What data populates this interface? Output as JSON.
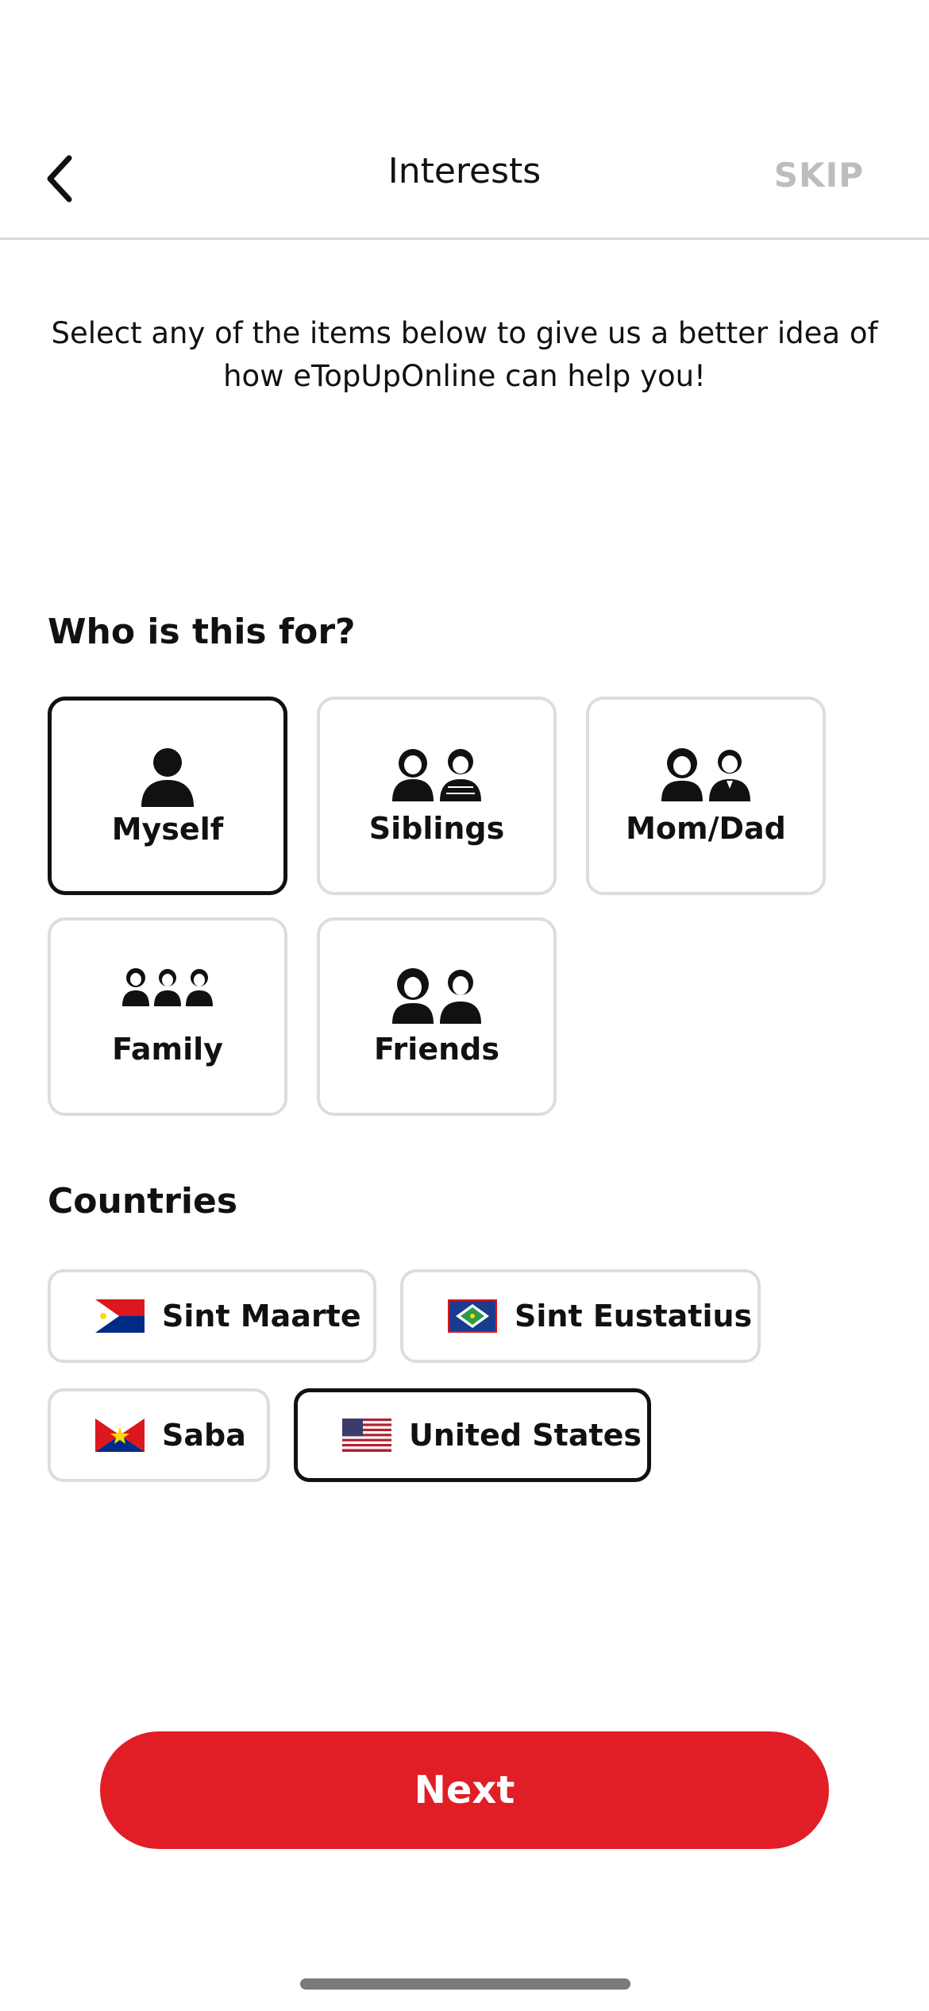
{
  "header": {
    "title": "Interests",
    "skip_label": "SKIP"
  },
  "intro_text": "Select any of the items below to give us a better idea of how eTopUpOnline can help you!",
  "who": {
    "title": "Who is this for?",
    "options": [
      {
        "label": "Myself",
        "icon": "person-icon",
        "selected": true
      },
      {
        "label": "Siblings",
        "icon": "siblings-icon",
        "selected": false
      },
      {
        "label": "Mom/Dad",
        "icon": "parents-icon",
        "selected": false
      },
      {
        "label": "Family",
        "icon": "family-icon",
        "selected": false
      },
      {
        "label": "Friends",
        "icon": "friends-icon",
        "selected": false
      }
    ]
  },
  "countries": {
    "title": "Countries",
    "options": [
      {
        "label": "Sint Maarte",
        "icon": "sint-maarten-flag-icon",
        "selected": false
      },
      {
        "label": "Sint Eustatius",
        "icon": "sint-eustatius-flag-icon",
        "selected": false
      },
      {
        "label": "Saba",
        "icon": "saba-flag-icon",
        "selected": false
      },
      {
        "label": "United States",
        "icon": "us-flag-icon",
        "selected": true
      }
    ]
  },
  "next_label": "Next",
  "colors": {
    "accent": "#e11d25",
    "selected_border": "#111111",
    "card_border": "#dddddd",
    "skip": "#bdbdbd"
  }
}
